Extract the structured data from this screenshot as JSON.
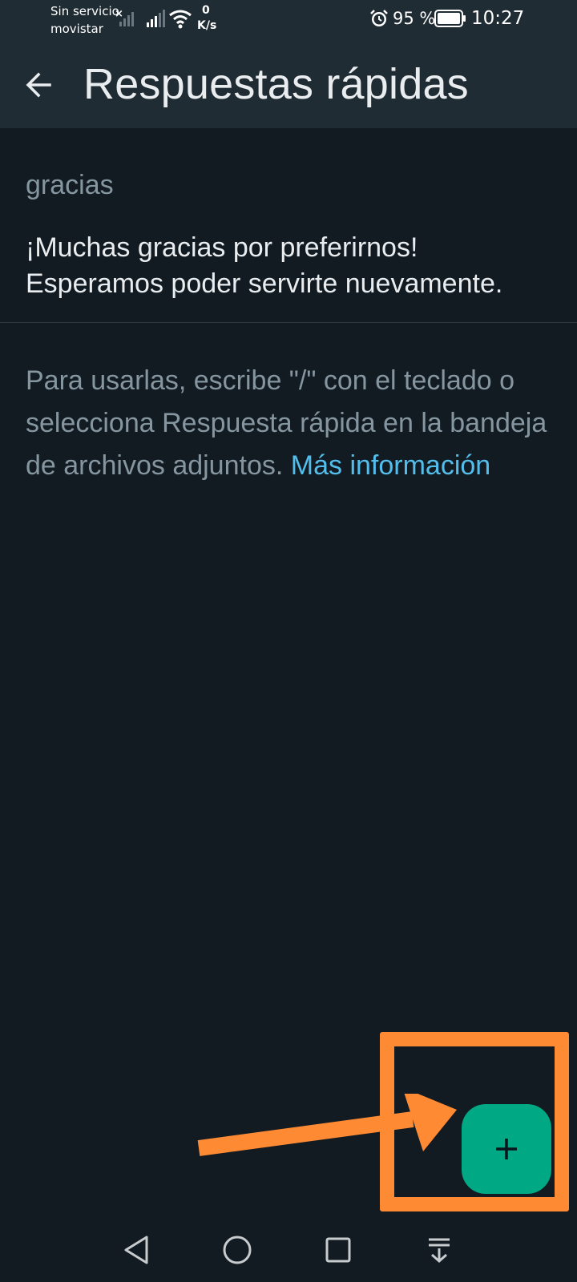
{
  "status_bar": {
    "carrier_line1": "Sin servicio",
    "carrier_line2": "movistar",
    "net_speed_value": "0",
    "net_speed_unit": "K/s",
    "battery": "95 %",
    "time": "10:27"
  },
  "app_bar": {
    "title": "Respuestas rápidas"
  },
  "quick_replies": [
    {
      "shortcut": "gracias",
      "message_line1": "¡Muchas gracias por preferirnos!",
      "message_line2": "Esperamos poder servirte nuevamente."
    }
  ],
  "help": {
    "text": "Para usarlas, escribe \"/\" con el teclado o selecciona Respuesta rápida en la bandeja de archivos adjuntos. ",
    "link": "Más información"
  },
  "fab": {
    "icon": "plus-icon"
  },
  "annotation": {
    "color": "#ff8a34"
  },
  "colors": {
    "background": "#121b22",
    "bar": "#202c33",
    "accent": "#00a884",
    "link": "#53bdeb"
  }
}
